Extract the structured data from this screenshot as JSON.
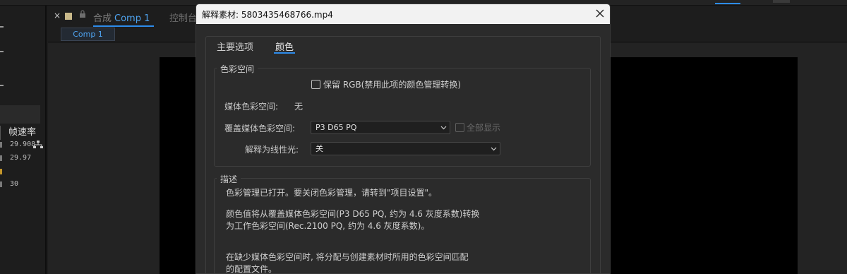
{
  "app": {
    "comp_tab": {
      "prefix": "合成",
      "comp_name": "Comp 1",
      "next_tab": "控制台"
    },
    "comp_chip": "Comp 1",
    "project_panel": {
      "column_header": "帧速率",
      "rows": [
        "29.908",
        "29.97",
        "",
        "30"
      ]
    }
  },
  "dialog": {
    "title": "解释素材: 5803435468766.mp4",
    "tabs": [
      {
        "label": "主要选项",
        "active": false
      },
      {
        "label": "颜色",
        "active": true
      }
    ],
    "color_space_group": {
      "legend": "色彩空间",
      "preserve_rgb_label": "保留 RGB(禁用此项的颜色管理转换)",
      "preserve_rgb_checked": false,
      "media_color_space_label": "媒体色彩空间:",
      "media_color_space_value": "无",
      "override_label": "覆盖媒体色彩空间:",
      "override_value": "P3 D65 PQ",
      "show_all_label": "全部显示",
      "show_all_checked": false,
      "linearize_label": "解释为线性光:",
      "linearize_value": "关"
    },
    "description_group": {
      "legend": "描述",
      "lines": [
        "色彩管理已打开。要关闭色彩管理，请转到\"项目设置\"。",
        "颜色值将从覆盖媒体色彩空间(P3 D65 PQ, 约为 4.6 灰度系数)转换",
        "为工作色彩空间(Rec.2100 PQ, 约为 4.6 灰度系数)。",
        "在缺少媒体色彩空间时, 将分配与创建素材时所用的色彩空间匹配",
        "的配置文件。"
      ]
    }
  },
  "colors": {
    "accent": "#2d8ceb",
    "dialog_bg": "#2b2b2b",
    "titlebar_bg": "#f2f2f2"
  }
}
